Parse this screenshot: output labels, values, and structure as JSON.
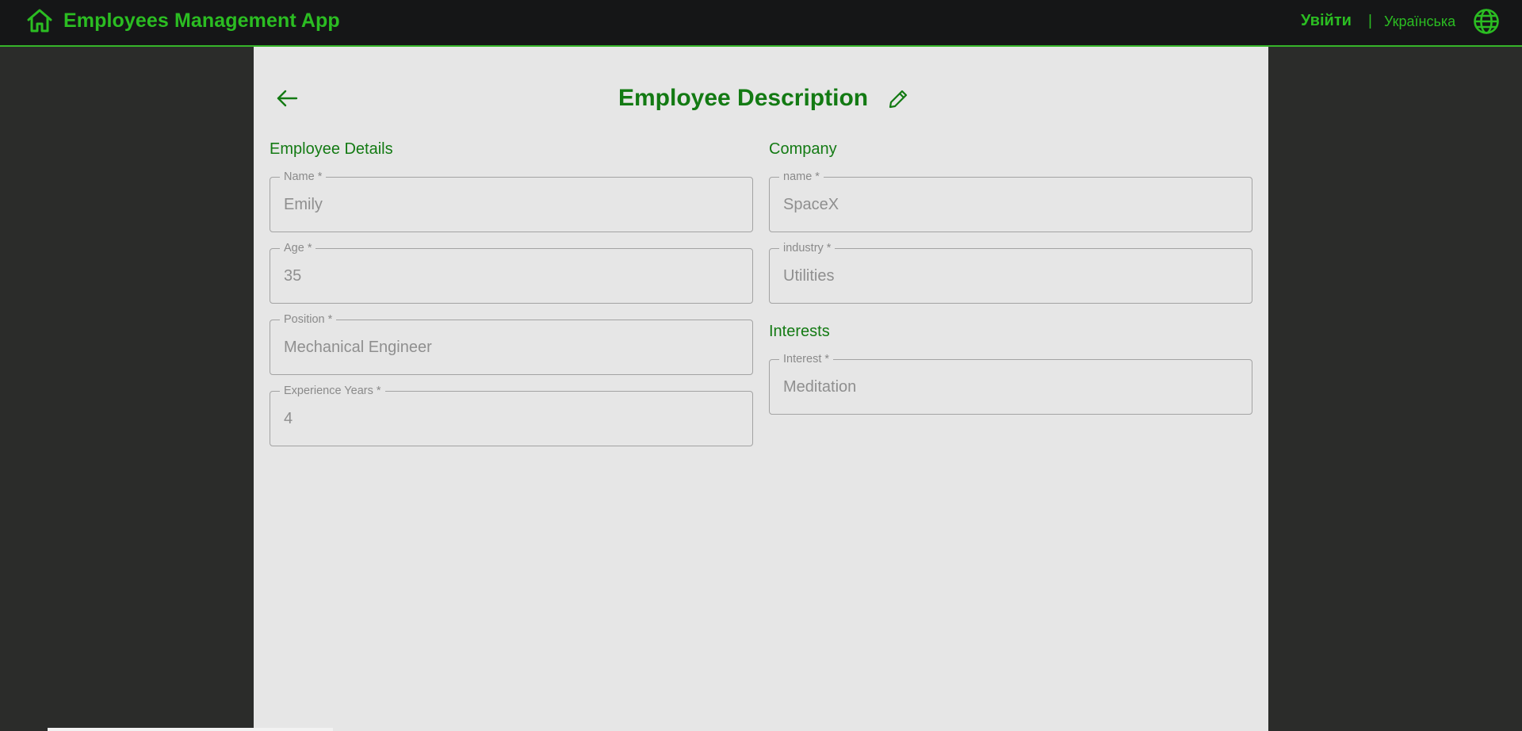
{
  "app": {
    "title": "Employees Management App",
    "login_label": "Увійти",
    "lang_separator": "|",
    "language": "Українська",
    "icons": {
      "home": "home-icon",
      "globe": "globe-icon",
      "back": "arrow-left-icon",
      "edit": "pencil-icon"
    },
    "colors": {
      "accent": "#2bbd22",
      "title_green": "#137a13",
      "topbar_bg": "#151617",
      "page_bg": "#2b2c2a",
      "panel_bg": "#e6e6e6"
    }
  },
  "page": {
    "title": "Employee Description"
  },
  "employee_details": {
    "section_title": "Employee Details",
    "fields": [
      {
        "label": "Name *",
        "value": "Emily"
      },
      {
        "label": "Age *",
        "value": "35"
      },
      {
        "label": "Position *",
        "value": "Mechanical Engineer"
      },
      {
        "label": "Experience Years *",
        "value": "4"
      }
    ]
  },
  "company": {
    "section_title": "Company",
    "fields": [
      {
        "label": "name *",
        "value": "SpaceX"
      },
      {
        "label": "industry *",
        "value": "Utilities"
      }
    ]
  },
  "interests": {
    "section_title": "Interests",
    "fields": [
      {
        "label": "Interest *",
        "value": "Meditation"
      }
    ]
  }
}
